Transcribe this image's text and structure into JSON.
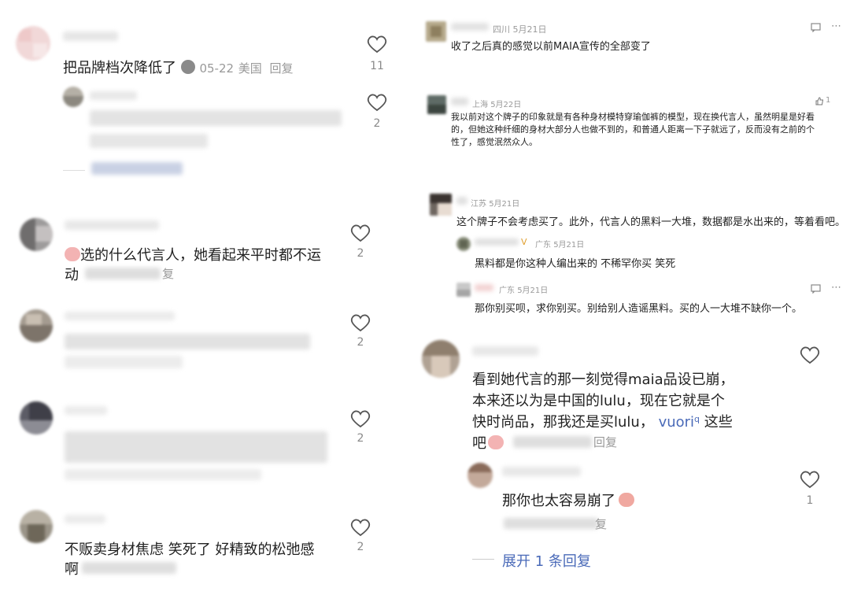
{
  "left_panel": {
    "comments": [
      {
        "text": "把品牌档次降低了",
        "emoji": "poop-emoji",
        "date": "05-22",
        "location": "美国",
        "reply_label": "回复",
        "likes": "11"
      },
      {
        "text": "",
        "likes": "2"
      },
      {
        "text_line1": "选的什么代言人，她看起来平时都不运",
        "text_line2": "动",
        "emoji": "peach-crying-emoji",
        "reply_fragment": "复",
        "likes": "2"
      },
      {
        "text": "",
        "likes": "2"
      },
      {
        "text": "",
        "likes": "2"
      },
      {
        "text_line1": "不贩卖身材焦虑 笑死了 好精致的松弛感",
        "text_line2": "啊",
        "likes": "2"
      }
    ]
  },
  "right_panel": {
    "comments": [
      {
        "location": "四川",
        "date": "5月21日",
        "text": "收了之后真的感觉以前MAIA宣传的全部变了"
      },
      {
        "location": "上海",
        "date": "5月22日",
        "likes": "1",
        "text_lines": [
          "我以前对这个牌子的印象就是有各种身材模特穿瑜伽裤的模型，现在换代言人，虽然明星是好看",
          "的，但她这种纤细的身材大部分人也做不到的，和普通人距离一下子就远了，反而没有之前的个",
          "性了，感觉泯然众人。"
        ]
      },
      {
        "location": "江苏",
        "date": "5月21日",
        "text": "这个牌子不会考虑买了。此外，代言人的黑料一大堆，数据都是水出来的，等着看吧。",
        "replies": [
          {
            "badge": "V",
            "location": "广东",
            "date": "5月21日",
            "text": "黑料都是你这种人编出来的 不稀罕你买 笑死"
          },
          {
            "location": "广东",
            "date": "5月21日",
            "text": "那你别买呗，求你别买。别给别人造谣黑料。买的人一大堆不缺你一个。"
          }
        ]
      },
      {
        "text_line1": "看到她代言的那一刻觉得maia品设已崩，",
        "text_line2": "本来还以为是中国的lulu，现在它就是个",
        "text_line3_a": "快时尚品，那我还是买lulu，",
        "text_line3_link": "vuori",
        "text_line3_b": " 这些",
        "text_line4": "吧",
        "reply_fragment": "回复",
        "likes": "",
        "reply": {
          "text": "那你也太容易崩了",
          "reply_fragment": "复",
          "likes": "1"
        },
        "expand_label": "展开 1 条回复"
      }
    ]
  },
  "colors": {
    "link": "#4a6ab8",
    "meta": "#999999",
    "heart": "#555555"
  }
}
